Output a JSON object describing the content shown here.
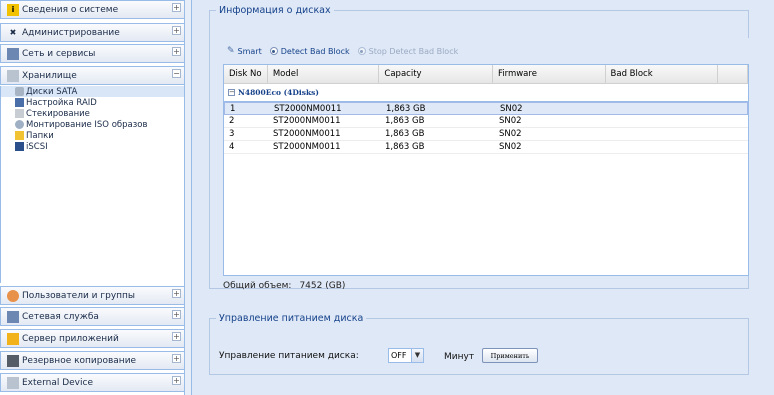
{
  "sidebar": {
    "top_sections": [
      {
        "label": "Сведения о системе",
        "icon": "info-icon"
      },
      {
        "label": "Администрирование",
        "icon": "tools-icon"
      },
      {
        "label": "Сеть и сервисы",
        "icon": "network-icon"
      },
      {
        "label": "Хранилище",
        "icon": "storage-icon"
      }
    ],
    "storage_items": [
      {
        "label": "Диски SATA",
        "icon": "disk-icon"
      },
      {
        "label": "Настройка RAID",
        "icon": "raid-icon"
      },
      {
        "label": "Стекирование",
        "icon": "stack-icon"
      },
      {
        "label": "Монтирование ISO образов",
        "icon": "iso-icon"
      },
      {
        "label": "Папки",
        "icon": "folder-icon"
      },
      {
        "label": "iSCSI",
        "icon": "iscsi-icon"
      }
    ],
    "bottom_sections": [
      {
        "label": "Пользователи и группы",
        "icon": "users-icon"
      },
      {
        "label": "Сетевая служба",
        "icon": "network-service-icon"
      },
      {
        "label": "Сервер приложений",
        "icon": "app-server-icon"
      },
      {
        "label": "Резервное копирование",
        "icon": "backup-icon"
      },
      {
        "label": "External Device",
        "icon": "external-device-icon"
      }
    ],
    "collapse_symbol": "+",
    "expanded_symbol": "−"
  },
  "disk_info": {
    "legend": "Информация о дисках",
    "toolbar": {
      "smart": "Smart",
      "detect": "Detect Bad Block",
      "stop": "Stop Detect Bad Block"
    },
    "columns": [
      "Disk No",
      "Model",
      "Capacity",
      "Firmware",
      "Bad Block"
    ],
    "group_label": "N4800Eco (4Disks)",
    "rows": [
      {
        "no": "1",
        "model": "ST2000NM0011",
        "capacity": "1,863 GB",
        "firmware": "SN02",
        "bad_block": ""
      },
      {
        "no": "2",
        "model": "ST2000NM0011",
        "capacity": "1,863 GB",
        "firmware": "SN02",
        "bad_block": ""
      },
      {
        "no": "3",
        "model": "ST2000NM0011",
        "capacity": "1,863 GB",
        "firmware": "SN02",
        "bad_block": ""
      },
      {
        "no": "4",
        "model": "ST2000NM0011",
        "capacity": "1,863 GB",
        "firmware": "SN02",
        "bad_block": ""
      }
    ],
    "total_label": "Общий объем:",
    "total_value": "7452 (GB)"
  },
  "power": {
    "legend": "Управление питанием диска",
    "label": "Управление питанием диска:",
    "select_value": "OFF",
    "minutes_label": "Минут",
    "apply_label": "Применить"
  },
  "colors": {
    "panel": "#dfe8f6",
    "border": "#99bbe8",
    "title_text": "#15428b",
    "selection": "#dfe8f6"
  }
}
